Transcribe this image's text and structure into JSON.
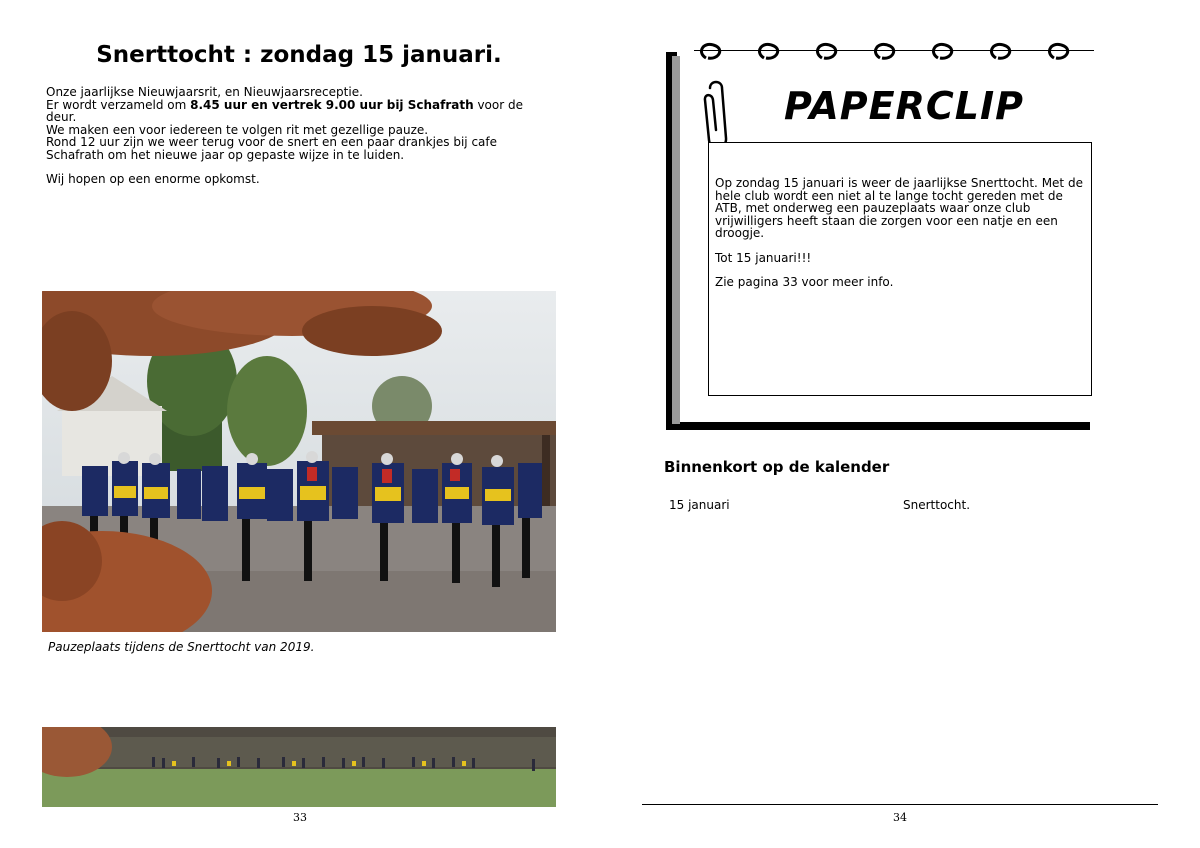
{
  "left_page": {
    "title": "Snerttocht : zondag 15 januari.",
    "line1": "Onze jaarlijkse Nieuwjaarsrit, en Nieuwjaarsreceptie.",
    "line2_pre": "Er wordt verzameld om ",
    "line2_bold": "8.45 uur en vertrek 9.00 uur bij Schafrath",
    "line2_post": " voor de deur.",
    "line3": "We maken een voor iedereen te volgen rit met gezellige pauze.",
    "line4": "Rond 12 uur zijn we weer terug voor de snert en een paar drankjes bij cafe Schafrath om het nieuwe jaar op gepaste wijze in te luiden.",
    "line5": "Wij hopen op een enorme opkomst.",
    "photo_caption": "Pauzeplaats tijdens de Snerttocht van 2019.",
    "page_number": "33"
  },
  "right_page": {
    "paperclip_title": "PAPERCLIP",
    "note_para1": "Op zondag 15 januari is weer de jaarlijkse Snerttocht. Met de hele club wordt een niet al te lange tocht gereden met de ATB, met onderweg een pauzeplaats waar onze club vrijwilligers heeft staan die zorgen voor een natje en een droogje.",
    "note_para2": "Tot 15 januari!!!",
    "note_para3": "Zie pagina 33 voor meer info.",
    "calendar_heading": "Binnenkort op de kalender",
    "calendar": [
      {
        "date": "15 januari",
        "event": "Snerttocht."
      }
    ],
    "page_number": "34"
  }
}
